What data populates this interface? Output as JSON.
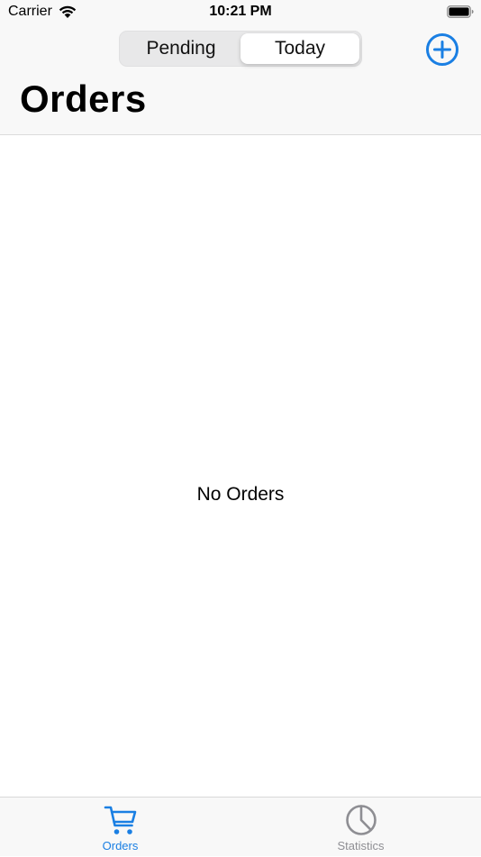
{
  "status_bar": {
    "carrier": "Carrier",
    "time": "10:21 PM"
  },
  "nav": {
    "segments": [
      {
        "label": "Pending",
        "selected": false
      },
      {
        "label": "Today",
        "selected": true
      }
    ],
    "title": "Orders",
    "add_icon": "plus-circle-icon"
  },
  "content": {
    "empty_message": "No Orders"
  },
  "tab_bar": {
    "items": [
      {
        "label": "Orders",
        "icon": "cart-icon",
        "active": true
      },
      {
        "label": "Statistics",
        "icon": "pie-chart-icon",
        "active": false
      }
    ]
  },
  "colors": {
    "accent": "#1a7fe3",
    "inactive": "#8e8e93",
    "bar_background": "#f8f8f8"
  }
}
